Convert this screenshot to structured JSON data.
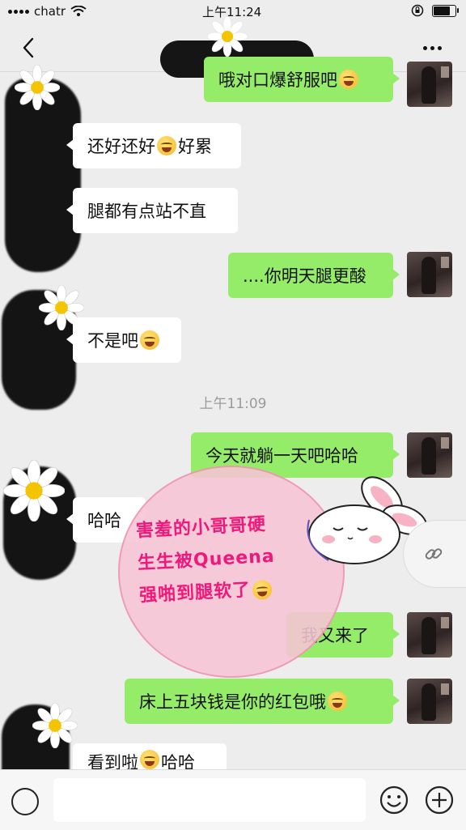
{
  "status_bar": {
    "carrier": "chatr",
    "time": "上午11:24"
  },
  "nav": {
    "back_icon": "chevron-left-icon",
    "more_icon": "more-dots-icon"
  },
  "messages": [
    {
      "side": "right",
      "text": "哦对口爆舒服吧",
      "emoji": "laugh-cry-emoji"
    },
    {
      "side": "left",
      "text_before": "还好还好",
      "emoji": "laugh-cry-emoji",
      "text_after": "好累"
    },
    {
      "side": "left",
      "text": "腿都有点站不直"
    },
    {
      "side": "right",
      "text": "....你明天腿更酸"
    },
    {
      "side": "left",
      "text": "不是吧",
      "emoji": "laugh-cry-emoji"
    },
    {
      "side": "right",
      "text": "今天就躺一天吧哈哈"
    },
    {
      "side": "left",
      "text": "哈哈"
    },
    {
      "side": "right",
      "text": "我又来了"
    },
    {
      "side": "right",
      "text": "床上五块钱是你的红包哦",
      "emoji": "joy-emoji"
    },
    {
      "side": "left",
      "text_before": "看到啦",
      "emoji": "laugh-cry-emoji",
      "text_after": "哈哈"
    }
  ],
  "timestamp": "上午11:09",
  "sticker": {
    "lines": [
      "害羞的小哥哥硬",
      "生生被Queena",
      "强啪到腿软了"
    ],
    "emoji": "smirk-emoji"
  },
  "link_float": {
    "icon": "link-icon"
  },
  "input_bar": {
    "placeholder": "",
    "voice_icon": "voice-icon",
    "emoji_icon": "smiley-icon",
    "plus_icon": "plus-icon"
  },
  "colors": {
    "bubble_right": "#95ec69",
    "bubble_left": "#ffffff",
    "background": "#ededed",
    "sticker_text": "#f0187a"
  }
}
